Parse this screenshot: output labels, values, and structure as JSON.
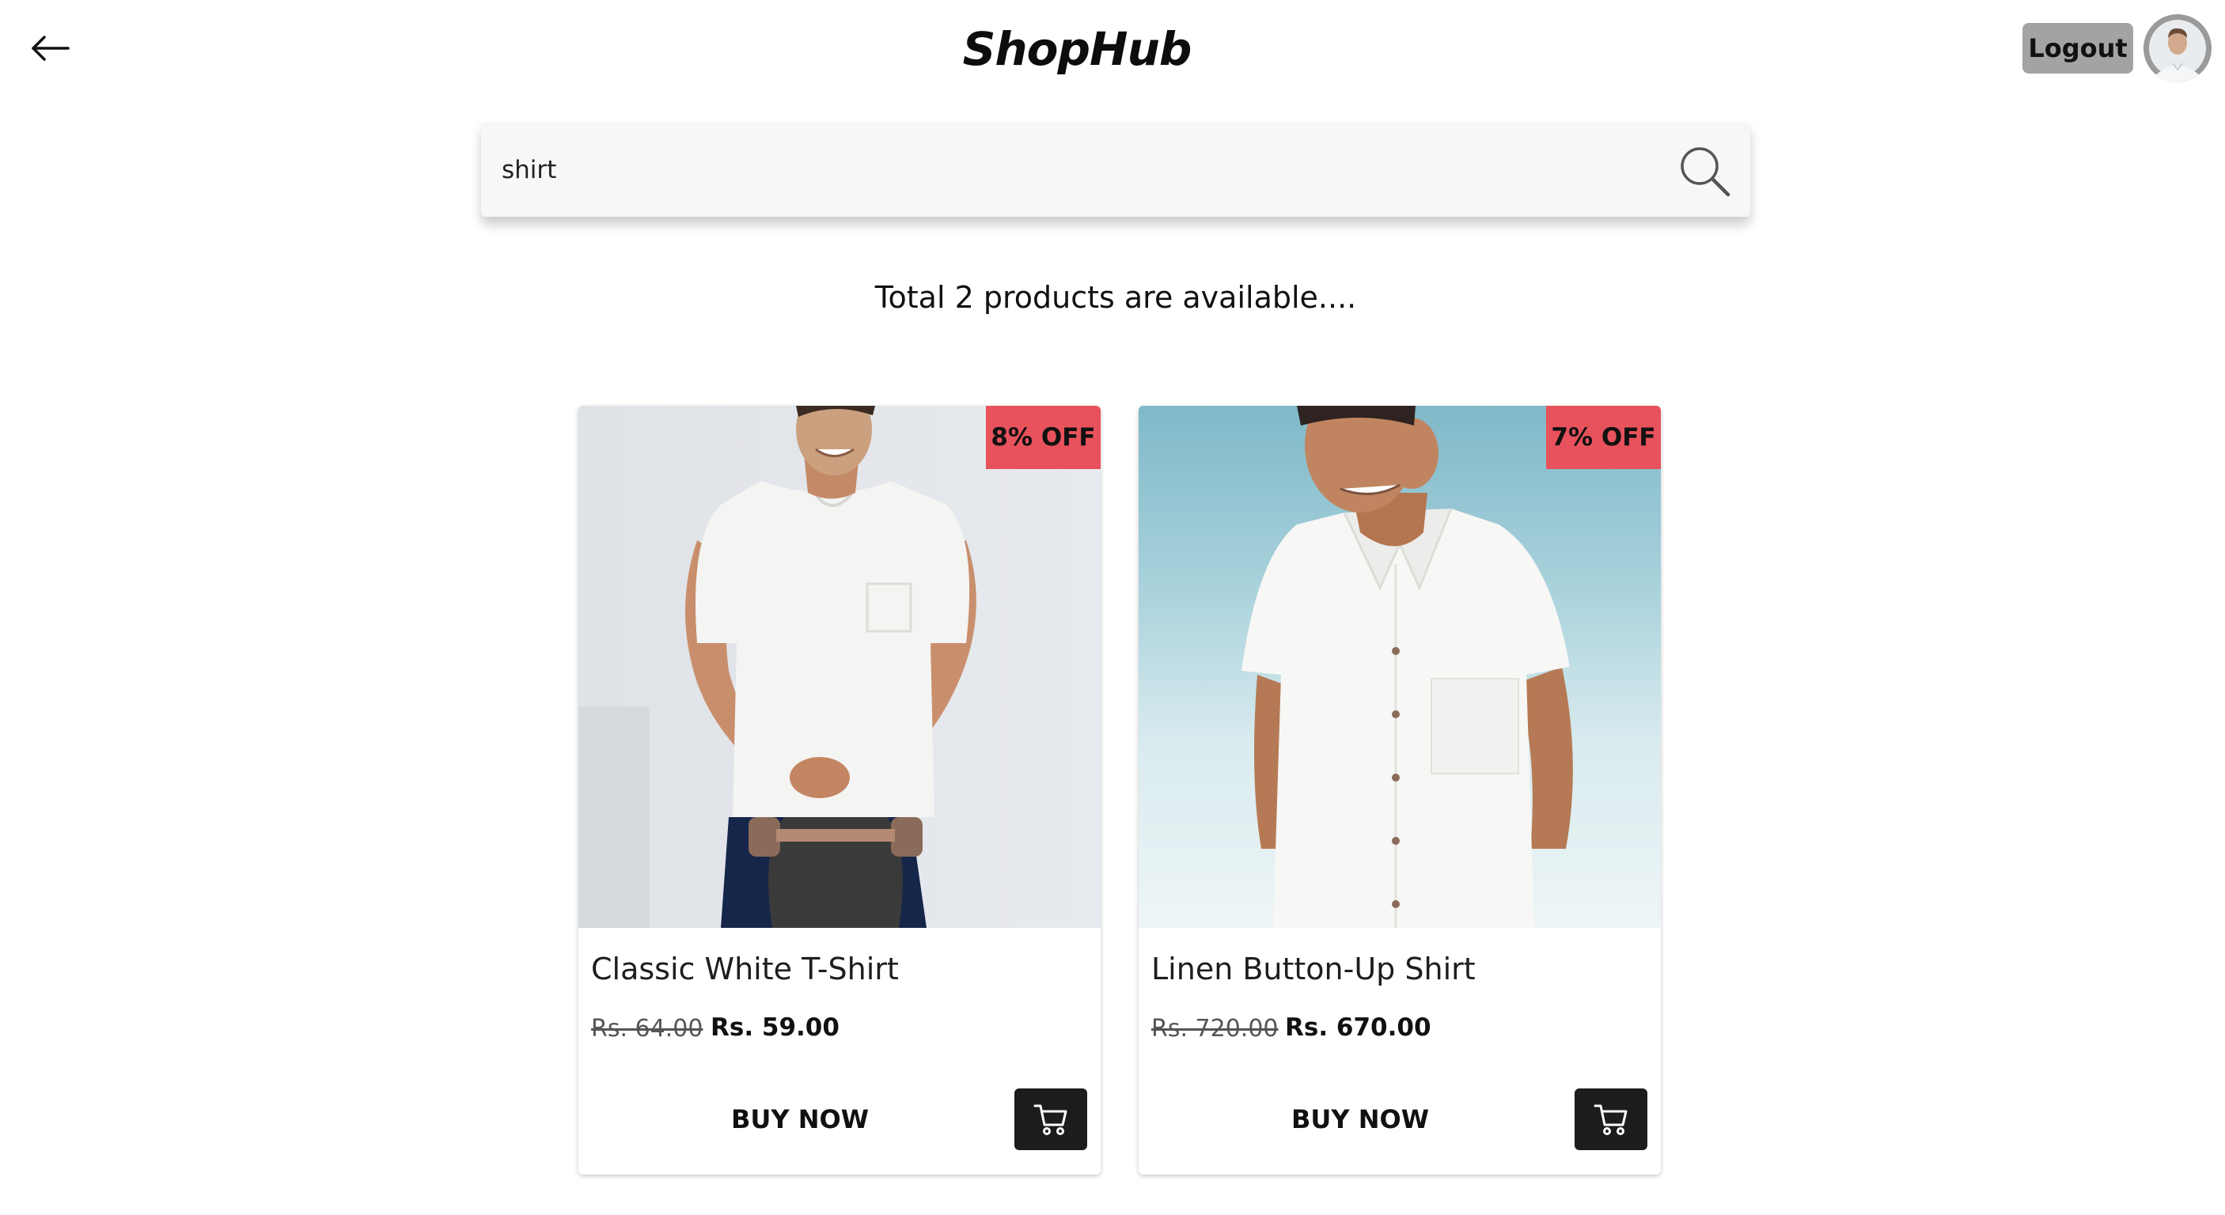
{
  "header": {
    "brand": "ShopHub",
    "logout_label": "Logout"
  },
  "search": {
    "value": "shirt",
    "placeholder": ""
  },
  "results": {
    "summary": "Total 2 products are available...."
  },
  "products": [
    {
      "name": "Classic White T-Shirt",
      "discount": "8% OFF",
      "old_price": "Rs. 64.00",
      "price": "Rs. 59.00",
      "buy_label": "BUY NOW"
    },
    {
      "name": "Linen Button-Up Shirt",
      "discount": "7% OFF",
      "old_price": "Rs. 720.00",
      "price": "Rs. 670.00",
      "buy_label": "BUY NOW"
    }
  ],
  "icons": {
    "back": "arrow-left-icon",
    "search": "search-icon",
    "cart": "cart-icon",
    "avatar": "user-avatar"
  },
  "colors": {
    "badge": "#e8525c",
    "cart_button": "#1c1c1e",
    "logout_button": "#a3a3a3"
  }
}
